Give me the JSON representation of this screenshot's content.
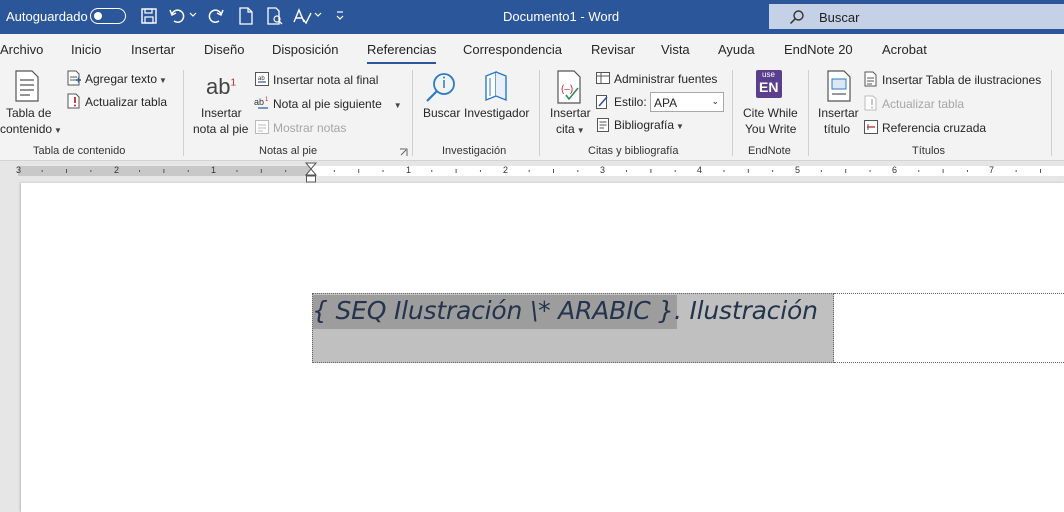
{
  "titlebar": {
    "autosave_label": "Autoguardado",
    "document_title": "Documento1",
    "separator": "-",
    "app_name": "Word",
    "search_label": "Buscar"
  },
  "menu": {
    "tabs": [
      "Archivo",
      "Inicio",
      "Insertar",
      "Diseño",
      "Disposición",
      "Referencias",
      "Correspondencia",
      "Revisar",
      "Vista",
      "Ayuda",
      "EndNote 20",
      "Acrobat"
    ],
    "active": "Referencias"
  },
  "ribbon": {
    "toc": {
      "big_button_line1": "Tabla de",
      "big_button_line2": "contenido",
      "add_text": "Agregar texto",
      "update_table": "Actualizar tabla",
      "group": "Tabla de contenido"
    },
    "footnotes": {
      "icon_text": "ab",
      "icon_sup": "1",
      "big_button_line1": "Insertar",
      "big_button_line2": "nota al pie",
      "insert_endnote": "Insertar nota al final",
      "next_footnote": "Nota al pie siguiente",
      "show_notes": "Mostrar notas",
      "group": "Notas al pie"
    },
    "research": {
      "search": "Buscar",
      "researcher": "Investigador",
      "group": "Investigación"
    },
    "citations": {
      "insert_line1": "Insertar",
      "insert_line2": "cita",
      "manage_sources": "Administrar fuentes",
      "style_label": "Estilo:",
      "style_value": "APA",
      "bibliography": "Bibliografía",
      "group": "Citas y bibliografía"
    },
    "endnote": {
      "badge_top": "use",
      "badge_main": "EN",
      "line1": "Cite While",
      "line2": "You Write",
      "group": "EndNote"
    },
    "captions": {
      "insert_line1": "Insertar",
      "insert_line2": "título",
      "insert_table_figures": "Insertar Tabla de ilustraciones",
      "update_table": "Actualizar tabla",
      "cross_reference": "Referencia cruzada",
      "group": "Títulos"
    }
  },
  "ruler": {
    "labels": [
      "3",
      "2",
      "1",
      "1",
      "2",
      "3",
      "4",
      "5",
      "6",
      "7"
    ]
  },
  "document": {
    "field_code": "{ SEQ Ilustración \\* ARABIC }",
    "field_suffix": ". Ilustración"
  },
  "colors": {
    "titlebar": "#2b579a",
    "ribbon_bg": "#f3f3f3",
    "field_highlight": "#c0c0c0",
    "field_code_highlight": "#9d9d9d",
    "doc_text": "#24344d"
  }
}
